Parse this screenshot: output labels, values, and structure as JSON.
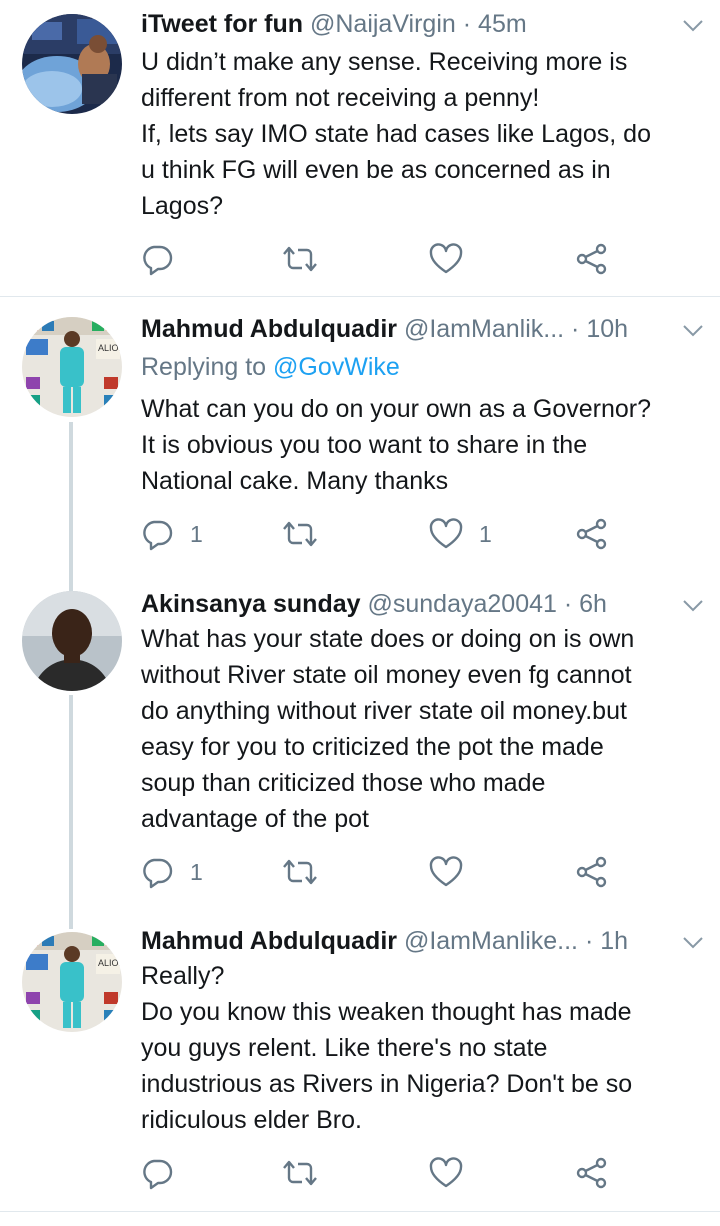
{
  "tweets": [
    {
      "display_name": "iTweet for fun",
      "handle": "@NaijaVirgin",
      "time": "45m",
      "replying_to": null,
      "lines": [
        "U didn’t make any sense. Receiving more is",
        "different from not receiving a penny!",
        "If, lets say IMO state had cases like Lagos, do",
        "u think FG will even be as concerned as in",
        "Lagos?"
      ],
      "reply_count": "",
      "retweet_count": "",
      "like_count": ""
    },
    {
      "display_name": "Mahmud Abdulquadir",
      "handle": "@IamManlik...",
      "time": "10h",
      "replying_to_label": "Replying to",
      "replying_to": "@GovWike",
      "lines": [
        "What can you do on your own as a Governor?",
        "It is obvious you too want to share in the",
        "National cake. Many thanks"
      ],
      "reply_count": "1",
      "retweet_count": "",
      "like_count": "1"
    },
    {
      "display_name": "Akinsanya sunday",
      "handle": "@sundaya20041",
      "time": "6h",
      "replying_to": null,
      "lines": [
        "What has your state does or doing on is own",
        "without River state oil money even fg cannot",
        "do anything without river state oil money.but",
        "easy for you to criticized the pot the made",
        "soup than criticized those who made",
        "advantage of the pot"
      ],
      "reply_count": "1",
      "retweet_count": "",
      "like_count": ""
    },
    {
      "display_name": "Mahmud Abdulquadir",
      "handle": "@IamManlike...",
      "time": "1h",
      "replying_to": null,
      "lines": [
        "Really?",
        "Do you know this weaken thought has made",
        "you guys relent. Like there's no state",
        "industrious as Rivers in Nigeria? Don't be so",
        "ridiculous elder Bro."
      ],
      "reply_count": "",
      "retweet_count": "",
      "like_count": ""
    }
  ],
  "separator": "·",
  "icons": {
    "reply": "reply-icon",
    "retweet": "retweet-icon",
    "like": "heart-icon",
    "share": "share-icon",
    "caret": "chevron-down-icon"
  },
  "colors": {
    "text": "#14171a",
    "secondary": "#657786",
    "link": "#1da1f2",
    "divider": "#e1e8ed",
    "thread_line": "#cfd9de"
  }
}
